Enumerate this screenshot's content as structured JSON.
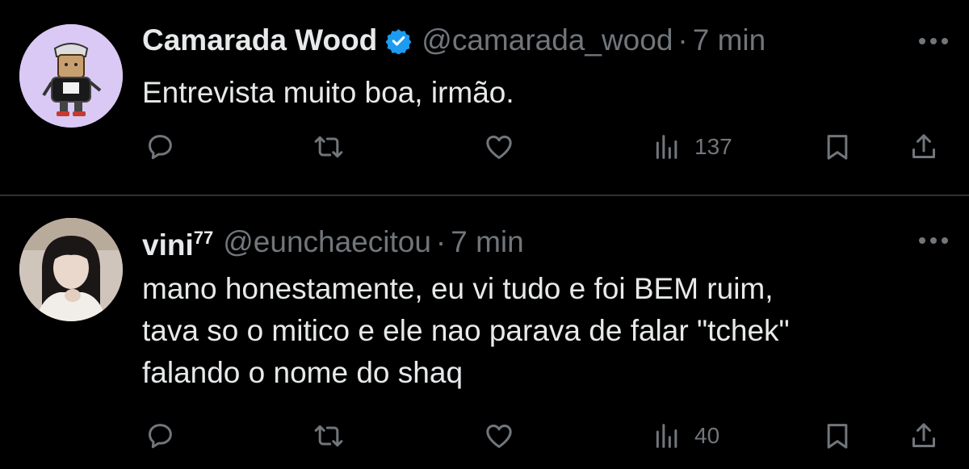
{
  "tweets": [
    {
      "display_name": "Camarada Wood",
      "display_name_suffix": "",
      "verified": true,
      "handle": "@camarada_wood",
      "separator": "·",
      "time": "7 min",
      "text_lines": [
        "Entrevista muito boa, irmão."
      ],
      "views": "137",
      "avatar": "cartoon-character-avatar"
    },
    {
      "display_name": "vini",
      "display_name_suffix": "77",
      "verified": false,
      "handle": "@eunchaecitou",
      "separator": "·",
      "time": "7 min",
      "text_lines": [
        "mano honestamente, eu vi tudo e foi BEM ruim,",
        "tava so o mitico e ele nao parava de falar \"tchek\"",
        "falando o nome do shaq"
      ],
      "views": "40",
      "avatar": "person-photo-avatar"
    }
  ],
  "icons": {
    "reply": "reply-icon",
    "retweet": "retweet-icon",
    "like": "heart-icon",
    "views": "views-chart-icon",
    "bookmark": "bookmark-icon",
    "share": "share-icon",
    "more": "more-dots-icon",
    "verified": "verified-badge-icon"
  },
  "colors": {
    "background": "#000000",
    "primary_text": "#e7e9ea",
    "secondary_text": "#71767b",
    "divider": "#2f3336",
    "verified_blue": "#1d9bf0"
  }
}
